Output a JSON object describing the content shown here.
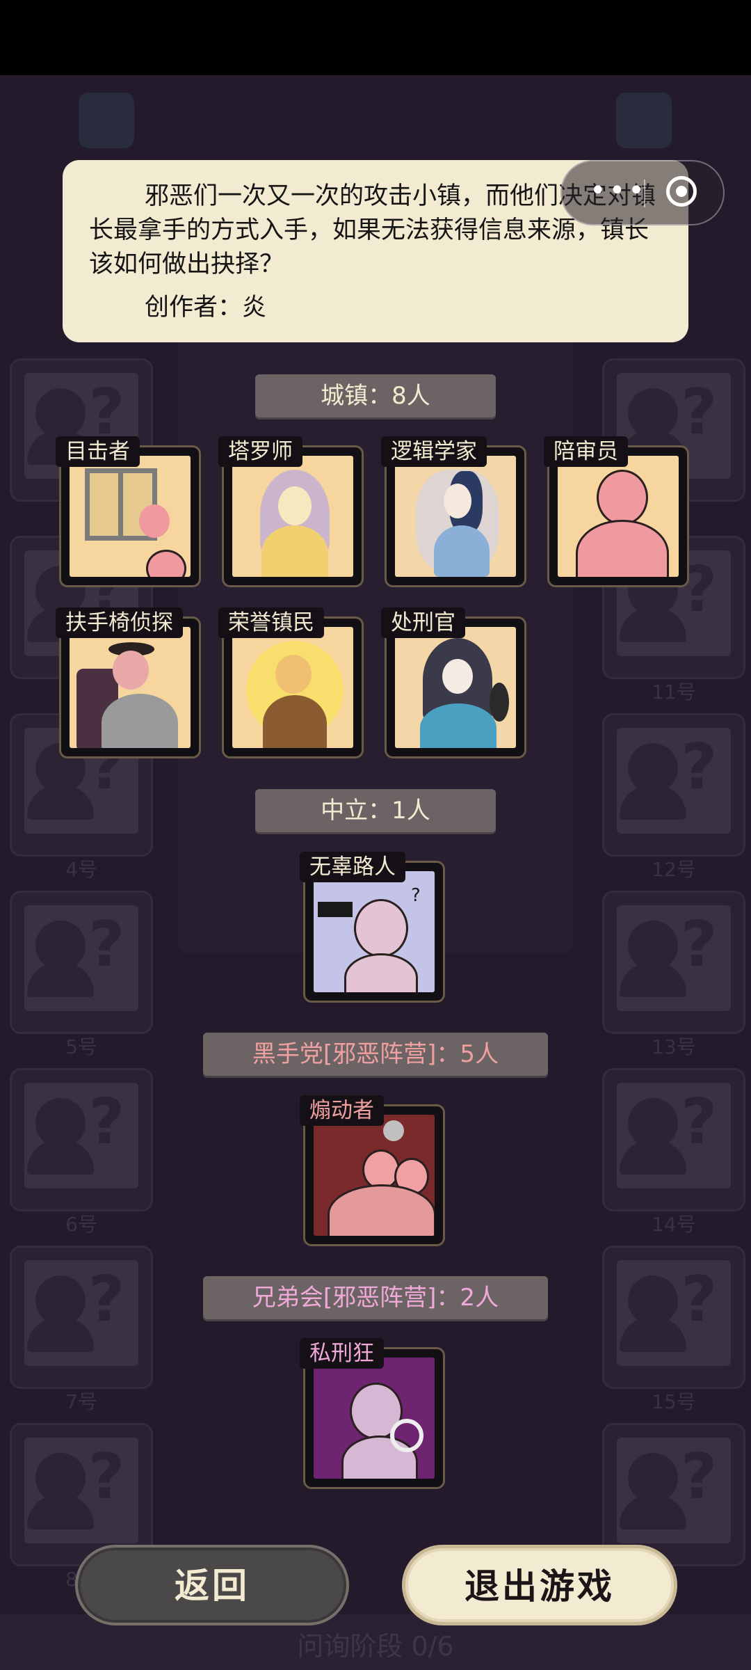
{
  "description": {
    "text": "邪恶们一次又一次的攻击小镇，而他们决定对镇长最拿手的方式入手，如果无法获得信息来源，镇长该如何做出抉择？",
    "author": "创作者：炎"
  },
  "sections": {
    "town": "城镇：8人",
    "neutral": "中立：1人",
    "mafia": "黑手党[邪恶阵营]：5人",
    "brotherhood": "兄弟会[邪恶阵营]：2人"
  },
  "roles": {
    "town": [
      "目击者",
      "塔罗师",
      "逻辑学家",
      "陪审员",
      "扶手椅侦探",
      "荣誉镇民",
      "处刑官"
    ],
    "neutral": [
      "无辜路人"
    ],
    "mafia": [
      "煽动者"
    ],
    "brotherhood": [
      "私刑狂"
    ]
  },
  "background": {
    "slot_numbers_left": [
      "4号",
      "5号",
      "6号",
      "7号",
      "8号"
    ],
    "slot_numbers_right": [
      "11号",
      "12号",
      "13号",
      "14号",
      "15号"
    ],
    "bottom_status": "问询阶段 0/6"
  },
  "buttons": {
    "back": "返回",
    "exit": "退出游戏"
  },
  "colors": {
    "cream": "#f3ead2",
    "evil_text": "#f0a0a0",
    "brotherhood_text": "#f0a8d8",
    "card_art": "#f7d59e"
  }
}
